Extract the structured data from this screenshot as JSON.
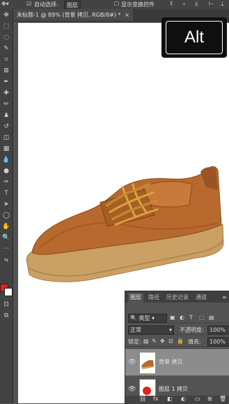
{
  "options_bar": {
    "auto_select_label": "自动选择:",
    "auto_select_value": "图层",
    "show_transform_label": "显示变换控件"
  },
  "document": {
    "tab_title": "未标题-1 @ 89% (背景 拷贝, RGB/8#) *",
    "close_glyph": "×"
  },
  "toolbar": {
    "tools": [
      "move-tool-icon",
      "marquee-tool-icon",
      "lasso-tool-icon",
      "quick-select-icon",
      "crop-tool-icon",
      "frame-tool-icon",
      "eyedropper-icon",
      "healing-brush-icon",
      "brush-tool-icon",
      "clone-stamp-icon",
      "history-brush-icon",
      "eraser-icon",
      "gradient-tool-icon",
      "blur-tool-icon",
      "dodge-tool-icon",
      "pen-tool-icon",
      "type-tool-icon",
      "path-select-icon",
      "shape-tool-icon",
      "hand-tool-icon",
      "zoom-tool-icon",
      "more-tools-icon"
    ],
    "foreground_color": "#e2231a",
    "background_color": "#ffffff"
  },
  "overlay": {
    "key_label": "Alt"
  },
  "layers_panel": {
    "tabs": [
      "图层",
      "路径",
      "历史记录",
      "通道"
    ],
    "filter_label": "类型",
    "blend_mode": "正常",
    "opacity_label": "不透明度:",
    "opacity_value": "100%",
    "lock_label": "锁定:",
    "fill_label": "填充:",
    "fill_value": "100%",
    "layers": [
      {
        "name": "背景 拷贝",
        "selected": true
      },
      {
        "name": "图层 1 拷贝",
        "selected": false
      }
    ]
  },
  "colors": {
    "selected_layer": "#8c8c8c",
    "leather": "#b8692e",
    "sole": "#caa064",
    "laces": "#d9a43a"
  }
}
